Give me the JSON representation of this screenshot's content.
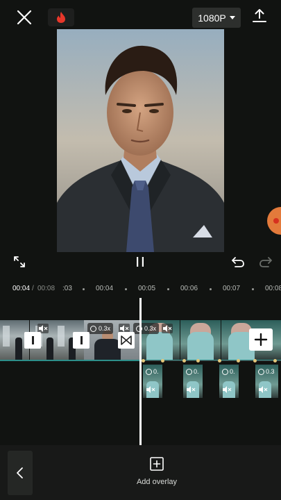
{
  "header": {
    "resolution": "1080P",
    "icons": [
      "close-icon",
      "flame-icon",
      "caret-down-icon",
      "export-icon"
    ]
  },
  "playback": {
    "icons": [
      "fullscreen-icon",
      "pause-icon",
      "undo-icon",
      "redo-icon"
    ]
  },
  "timeline": {
    "current_time": "00:04",
    "separator": "/",
    "total_time": "00:08",
    "ticks": ":03",
    "tick_04": "00:04",
    "tick_05": "00:05",
    "tick_06": "00:06",
    "tick_07": "00:07",
    "tick_08": "00:08"
  },
  "main_track": {
    "speed_1": "0.3x",
    "speed_2": "0.3x"
  },
  "overlay_track": {
    "clip_1_speed": "0.",
    "clip_2_speed": "0.",
    "clip_3_speed": "0.",
    "clip_4_speed": "0.3"
  },
  "bottom": {
    "add_overlay_label": "Add overlay"
  },
  "colors": {
    "background": "#111311",
    "accent_track": "#2d8f8a",
    "keyframe": "#e4c77a",
    "flame": "#e8372a",
    "record": "#e37a3b"
  }
}
